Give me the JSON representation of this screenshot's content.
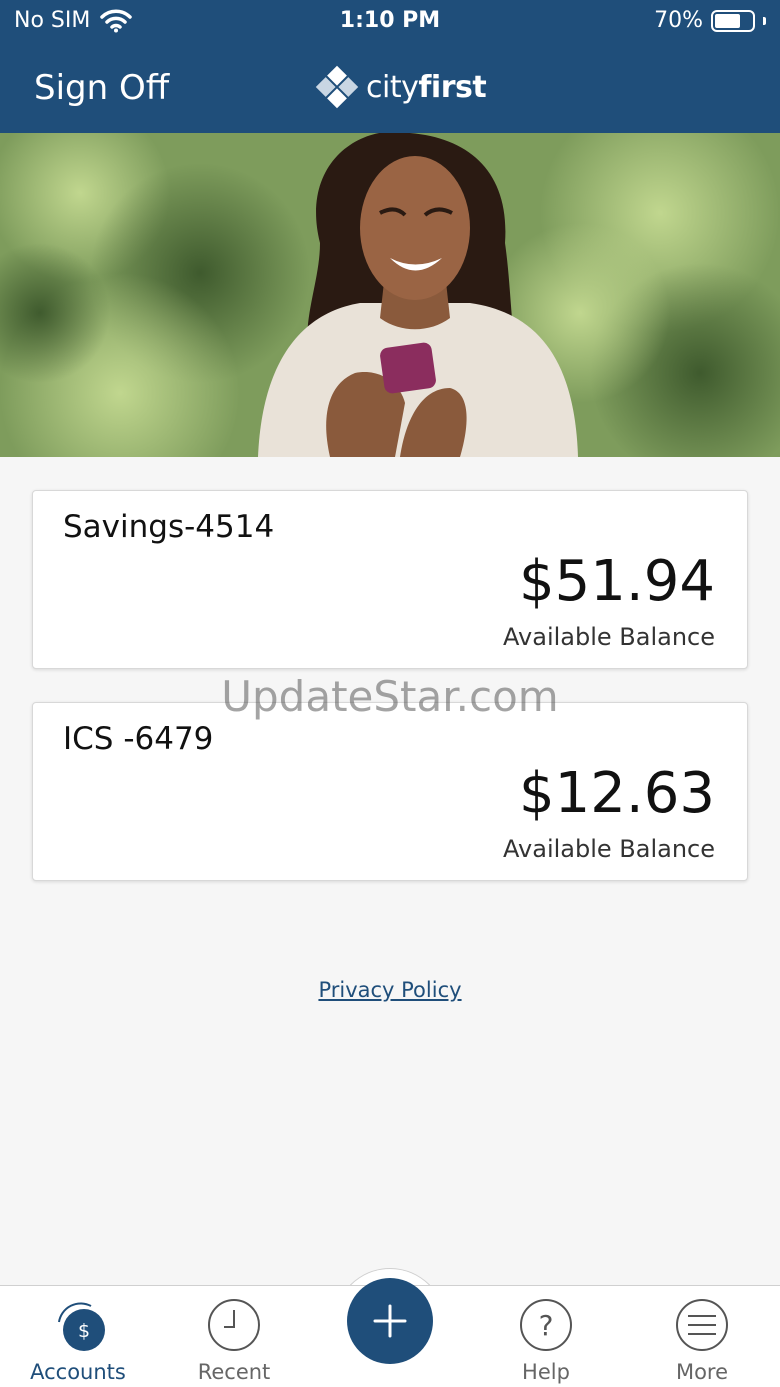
{
  "status_bar": {
    "carrier": "No SIM",
    "time": "1:10 PM",
    "battery": "70%",
    "battery_level": 0.7
  },
  "header": {
    "sign_off_label": "Sign Off",
    "logo_text_regular": "city",
    "logo_text_bold": "first",
    "bg_color": "#1f4e7a"
  },
  "accounts": [
    {
      "name": "Savings-4514",
      "balance": "$51.94",
      "balance_label": "Available Balance"
    },
    {
      "name": "ICS -6479",
      "balance": "$12.63",
      "balance_label": "Available Balance"
    }
  ],
  "watermark": "UpdateStar.com",
  "privacy_policy_label": "Privacy Policy",
  "tabs": [
    {
      "label": "Accounts",
      "icon": "dollar-icon",
      "active": true
    },
    {
      "label": "Recent",
      "icon": "clock-icon",
      "active": false
    },
    {
      "label": "",
      "icon": "plus-icon",
      "active": false
    },
    {
      "label": "Help",
      "icon": "question-icon",
      "active": false
    },
    {
      "label": "More",
      "icon": "menu-icon",
      "active": false
    }
  ],
  "accent_color": "#1f4e7a"
}
